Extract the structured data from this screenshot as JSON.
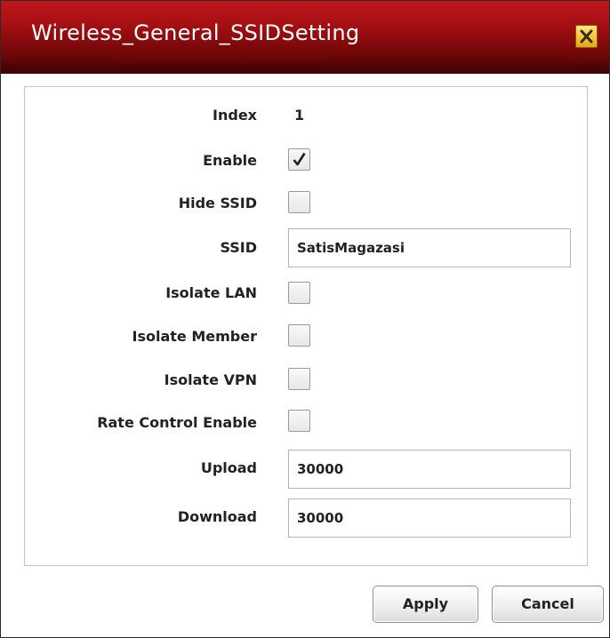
{
  "dialog": {
    "title": "Wireless_General_SSIDSetting",
    "close_icon": "close-icon",
    "colors": {
      "title_bar_top": "#c0171b",
      "title_bar_bottom": "#3c0203",
      "close_button": "#f5c43a"
    }
  },
  "form": {
    "index": {
      "label": "Index",
      "value": "1"
    },
    "enable": {
      "label": "Enable",
      "checked": true
    },
    "hide_ssid": {
      "label": "Hide SSID",
      "checked": false
    },
    "ssid": {
      "label": "SSID",
      "value": "SatisMagazasi"
    },
    "isolate_lan": {
      "label": "Isolate LAN",
      "checked": false
    },
    "isolate_member": {
      "label": "Isolate Member",
      "checked": false
    },
    "isolate_vpn": {
      "label": "Isolate VPN",
      "checked": false
    },
    "rate_control_enable": {
      "label": "Rate Control Enable",
      "checked": false
    },
    "upload": {
      "label": "Upload",
      "value": "30000"
    },
    "download": {
      "label": "Download",
      "value": "30000"
    }
  },
  "buttons": {
    "apply": "Apply",
    "cancel": "Cancel"
  }
}
